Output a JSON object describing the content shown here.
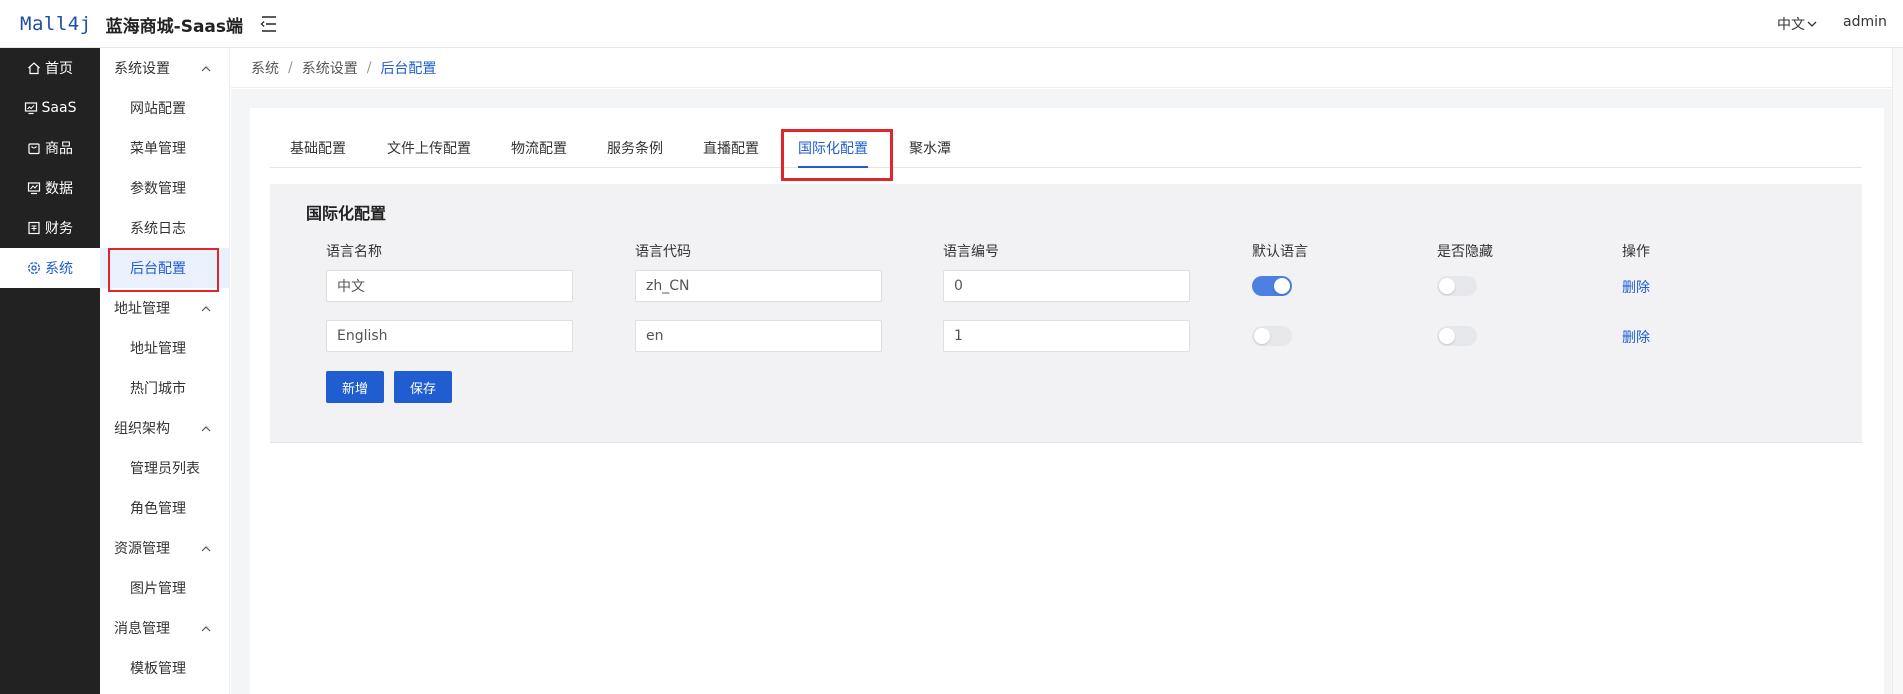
{
  "header": {
    "logo_mark": "Mall4j",
    "title": "蓝海商城-Saas端",
    "language": "中文",
    "user": "admin"
  },
  "primary_nav": [
    {
      "label": "首页",
      "icon": "home-icon"
    },
    {
      "label": "SaaS",
      "icon": "monitor-icon"
    },
    {
      "label": "商品",
      "icon": "bag-icon"
    },
    {
      "label": "数据",
      "icon": "chart-icon"
    },
    {
      "label": "财务",
      "icon": "finance-icon"
    },
    {
      "label": "系统",
      "icon": "gear-icon",
      "active": true
    }
  ],
  "secondary_nav": {
    "groups": [
      {
        "label": "系统设置",
        "items": [
          "网站配置",
          "菜单管理",
          "参数管理",
          "系统日志",
          "后台配置"
        ]
      },
      {
        "label": "地址管理",
        "items": [
          "地址管理",
          "热门城市"
        ]
      },
      {
        "label": "组织架构",
        "items": [
          "管理员列表",
          "角色管理"
        ]
      },
      {
        "label": "资源管理",
        "items": [
          "图片管理"
        ]
      },
      {
        "label": "消息管理",
        "items": [
          "模板管理"
        ]
      }
    ],
    "active_item": "后台配置"
  },
  "breadcrumb": {
    "items": [
      "系统",
      "系统设置",
      "后台配置"
    ],
    "separator": "/"
  },
  "tabs": [
    "基础配置",
    "文件上传配置",
    "物流配置",
    "服务条例",
    "直播配置",
    "国际化配置",
    "聚水潭"
  ],
  "active_tab": "国际化配置",
  "panel": {
    "title": "国际化配置",
    "columns": [
      "语言名称",
      "语言代码",
      "语言编号",
      "默认语言",
      "是否隐藏",
      "操作"
    ],
    "rows": [
      {
        "name": "中文",
        "code": "zh_CN",
        "number": "0",
        "default": true,
        "hidden": false,
        "action": "删除"
      },
      {
        "name": "English",
        "code": "en",
        "number": "1",
        "default": false,
        "hidden": false,
        "action": "删除"
      }
    ],
    "add_label": "新增",
    "save_label": "保存"
  },
  "colors": {
    "primary": "#1f5dd1",
    "sidebar_dark": "#222222",
    "highlight_red": "#e0252c"
  }
}
